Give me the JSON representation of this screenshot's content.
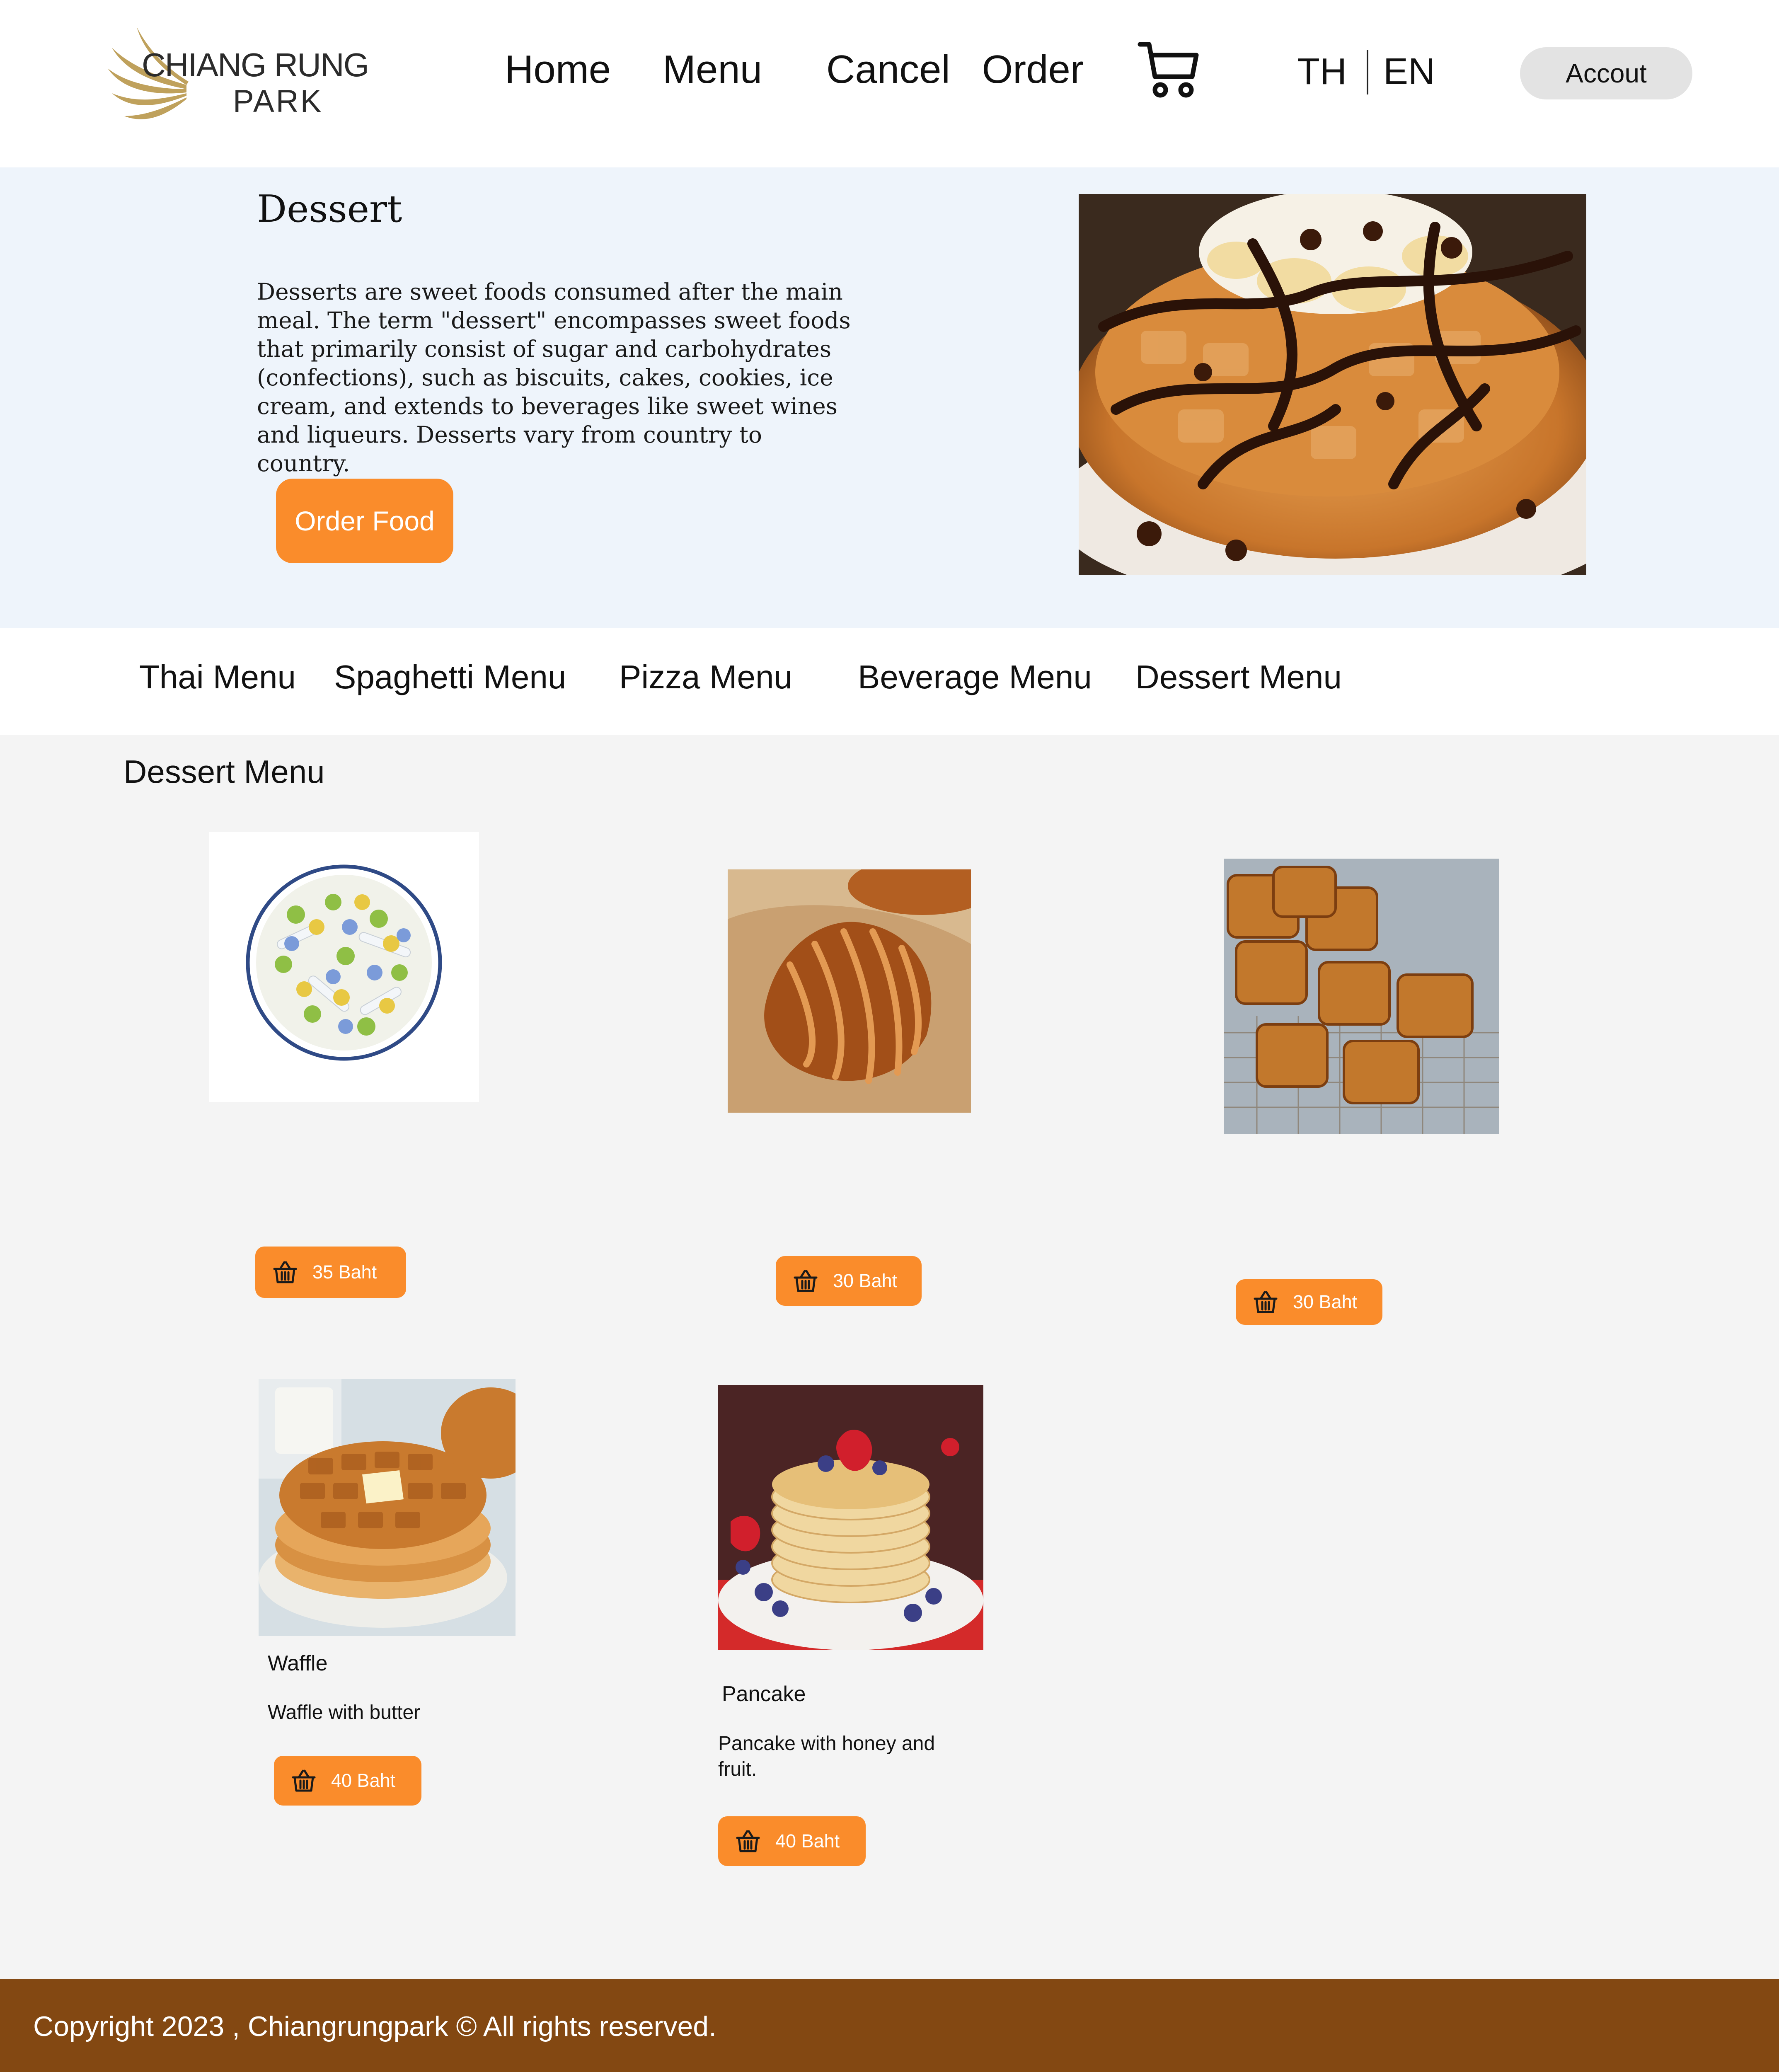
{
  "brand": {
    "line1": "CHIANG RUNG",
    "line2": "PARK"
  },
  "nav": {
    "home": "Home",
    "menu": "Menu",
    "cancel": "Cancel",
    "order": "Order",
    "cart_icon": "cart-icon"
  },
  "lang": {
    "th": "TH",
    "en": "EN"
  },
  "account": {
    "label": "Accout"
  },
  "hero": {
    "title": "Dessert",
    "description": "Desserts are sweet foods consumed after the main meal. The term \"dessert\" encompasses sweet foods that primarily consist of sugar and carbohydrates (confections), such as biscuits, cakes, cookies, ice cream, and extends to beverages like sweet wines and liqueurs. Desserts vary from country to country.",
    "button": "Order Food"
  },
  "categories": [
    "Thai Menu",
    "Spaghetti Menu",
    "Pizza Menu",
    "Beverage Menu",
    "Dessert Menu"
  ],
  "section": {
    "title": "Dessert Menu"
  },
  "items": [
    {
      "name": "",
      "description": "",
      "price": "35 Baht"
    },
    {
      "name": "",
      "description": "",
      "price": "30 Baht"
    },
    {
      "name": "",
      "description": "",
      "price": "30 Baht"
    },
    {
      "name": "Waffle",
      "description": "Waffle with butter",
      "price": "40 Baht"
    },
    {
      "name": "Pancake",
      "description": "Pancake with honey and fruit.",
      "price": "40 Baht"
    }
  ],
  "footer": {
    "copyright": "Copyright 2023 , Chiangrungpark © All rights reserved."
  },
  "colors": {
    "accent": "#fa8c2b",
    "footer": "#834812",
    "hero_bg": "#eef4fb",
    "logo_gold": "#bfa15c"
  }
}
